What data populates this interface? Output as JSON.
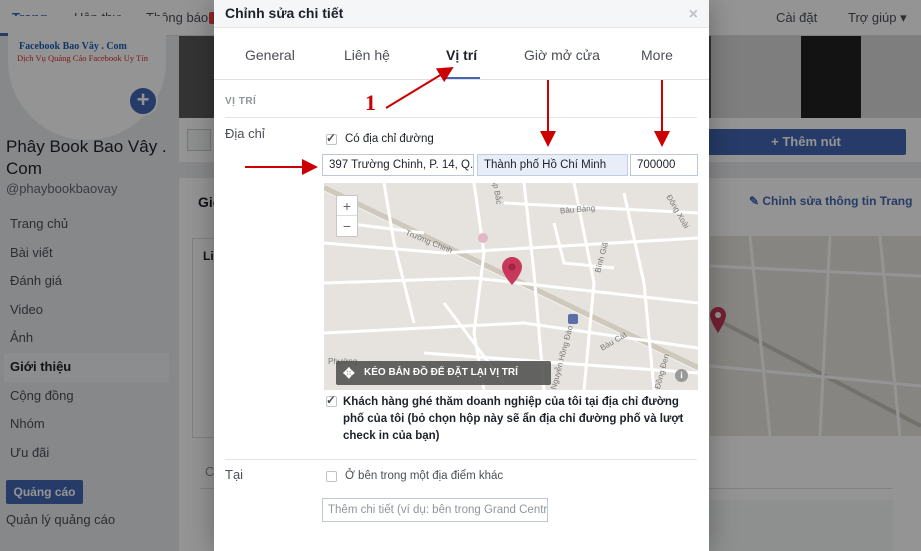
{
  "topbar": {
    "tabs": [
      "Trang",
      "Hộp thư",
      "Thông báo"
    ],
    "right": [
      "Cài đặt",
      "Trợ giúp ▾"
    ]
  },
  "sidebar": {
    "avatar_text": "Facebook Bao Vây . Com",
    "avatar_sub": "Dịch Vụ Quảng Cáo Facebook Uy Tín",
    "page_name": "Phây Book Bao Vây . Com",
    "handle": "@phaybookbaovay",
    "nav": [
      "Trang chủ",
      "Bài viết",
      "Đánh giá",
      "Video",
      "Ảnh",
      "Giới thiệu",
      "Cộng đồng",
      "Nhóm",
      "Ưu đãi"
    ],
    "ads_button": "Quảng cáo",
    "ads_manager": "Quản lý quảng cáo"
  },
  "main": {
    "add_button": "+ Thêm nút",
    "intro_heading": "Giới",
    "edit_link": "✎ Chỉnh sửa thông tin Trang",
    "card_letter_l": "Li",
    "card_letter_c": "C"
  },
  "modal": {
    "title": "Chỉnh sửa chi tiết",
    "close": "×",
    "tabs": [
      "General",
      "Liên hệ",
      "Vị trí",
      "Giờ mở cửa",
      "More"
    ],
    "section_title": "VỊ TRÍ",
    "address_label": "Địa chỉ",
    "has_street_label": "Có địa chỉ đường",
    "street_value": "397 Trường Chinh, P. 14, Q.",
    "city_value": "Thành phố Hồ Chí Minh",
    "zip_value": "700000",
    "map": {
      "zoom_in": "+",
      "zoom_out": "−",
      "banner": "KÉO BẢN ĐỒ ĐỂ ĐẶT LẠI VỊ TRÍ",
      "labels": [
        "Trường Chinh",
        "Bàu Bàng",
        "Ấp Bắc",
        "Đông Xoài",
        "Bình Giã",
        "Phường",
        "Nguyễn Hồng Đào",
        "Bàu Cát",
        "Đồng Đen"
      ]
    },
    "visit_checkbox": "Khách hàng ghé thăm doanh nghiệp của tôi tại địa chỉ đường phố của tôi (bỏ chọn hộp này sẽ ẩn địa chỉ đường phố và lượt check in của bạn)",
    "at_label": "Tại",
    "inside_other_label": "Ở bên trong một địa điểm khác",
    "detail_placeholder": "Thêm chi tiết (ví dụ: bên trong Grand Central)"
  },
  "annotation": {
    "number": "1",
    "color": "#cc0000"
  },
  "colors": {
    "brand": "#4267b2",
    "pin": "#c8385a"
  }
}
